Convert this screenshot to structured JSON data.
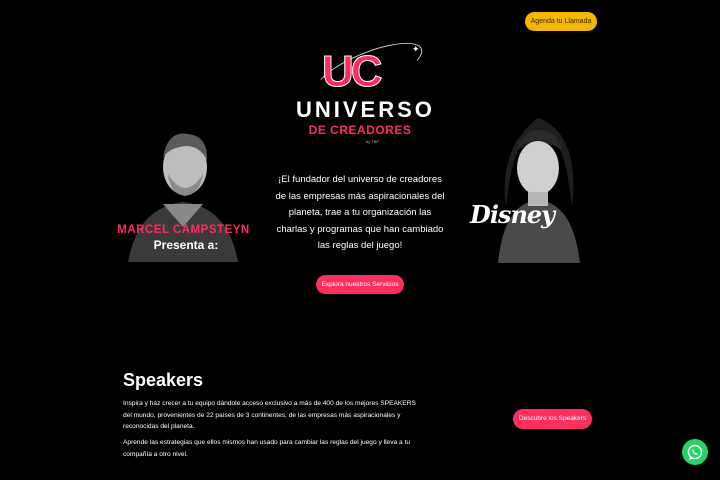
{
  "header": {
    "cta_label": "Agenda tu Llamada"
  },
  "logo": {
    "uc": "UC",
    "universo": "UNIVERSO",
    "creadores": "DE CREADORES",
    "by": "by TBP"
  },
  "hero": {
    "left_name": "MARCEL CAMPSTEYN",
    "left_sub": "Presenta a:",
    "right_brand": "Disney",
    "intro": "¡El fundador del universo de creadores de las empresas más aspiracionales del planeta, trae a tu organización las charlas y programas que han cambiado las reglas del juego!",
    "explore_label": "Explora nuestros Servicios"
  },
  "speakers": {
    "title": "Speakers",
    "p1": "Inspira y haz crecer a tu equipo dándole acceso exclusivo a más de 400 de los mejores SPEAKERS del mundo, provenientes de 22 países de 3 continentes, de las empresas más aspiracionales y reconocidas del planeta.",
    "p2": "Aprende las estrategias que ellos mismos han usado para cambiar las reglas del juego y lleva a tu compañía a otro nivel.",
    "cta_label": "Descubre los Speakers"
  },
  "floating": {
    "icon": "whatsapp-icon"
  },
  "colors": {
    "accent": "#ff2f5f",
    "cta_yellow": "#f5b700",
    "whatsapp": "#25d366",
    "background": "#000000"
  }
}
